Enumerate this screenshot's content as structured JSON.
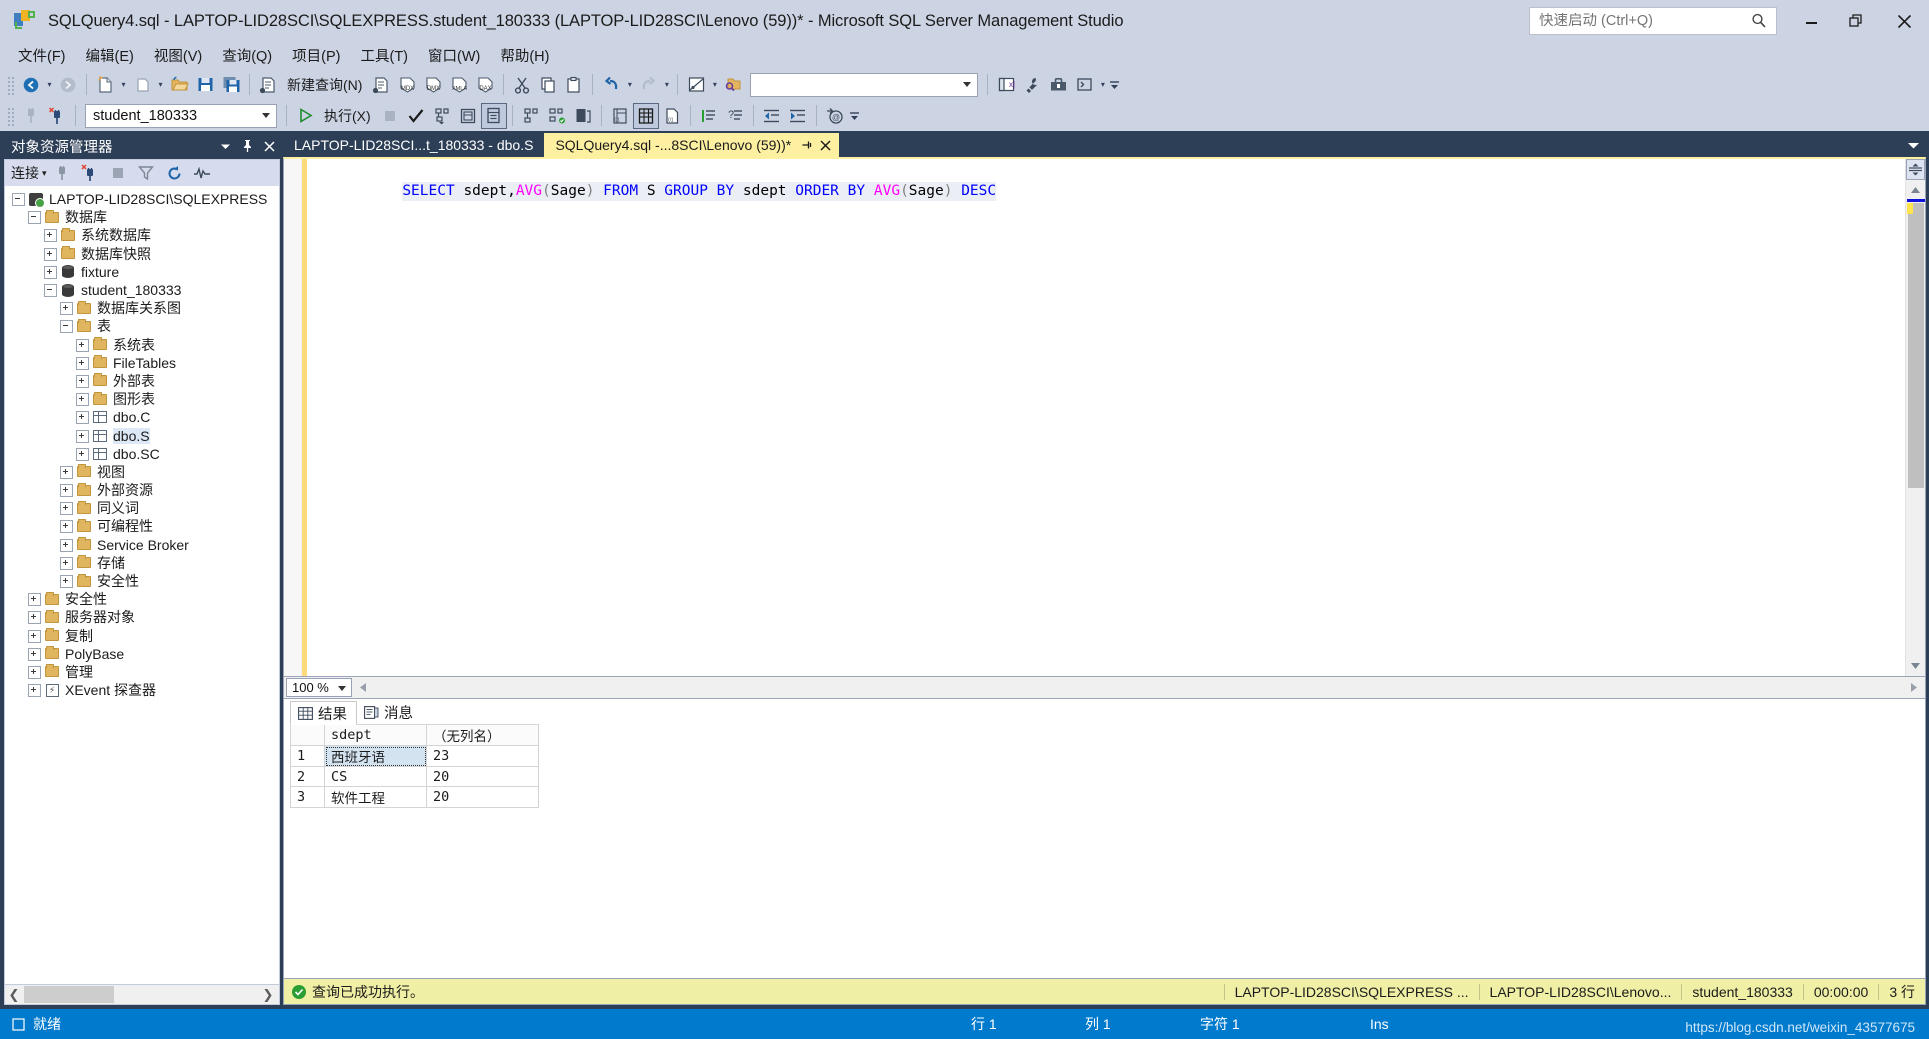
{
  "window": {
    "title": "SQLQuery4.sql - LAPTOP-LID28SCI\\SQLEXPRESS.student_180333 (LAPTOP-LID28SCI\\Lenovo (59))* - Microsoft SQL Server Management Studio",
    "app_icon": "ssms-icon",
    "minimize_label": "最小化",
    "restore_label": "还原",
    "close_label": "关闭"
  },
  "quick_launch": {
    "placeholder": "快速启动 (Ctrl+Q)",
    "value": "",
    "icon": "search-icon"
  },
  "menu": {
    "items": [
      {
        "label": "文件(F)",
        "name": "menu-file"
      },
      {
        "label": "编辑(E)",
        "name": "menu-edit"
      },
      {
        "label": "视图(V)",
        "name": "menu-view"
      },
      {
        "label": "查询(Q)",
        "name": "menu-query"
      },
      {
        "label": "项目(P)",
        "name": "menu-project"
      },
      {
        "label": "工具(T)",
        "name": "menu-tools"
      },
      {
        "label": "窗口(W)",
        "name": "menu-window"
      },
      {
        "label": "帮助(H)",
        "name": "menu-help"
      }
    ]
  },
  "toolbar_row1": {
    "new_query_label": "新建查询(N)",
    "buttons": [
      "navigate-back-icon",
      "navigate-forward-icon",
      "new-project-icon",
      "new-item-icon",
      "open-file-icon",
      "save-icon",
      "save-all-icon",
      "new-query-icon",
      "new-query-with-current-connection-icon",
      "new-mdx-query-icon",
      "new-dmx-query-icon",
      "new-xmla-query-icon",
      "new-dax-query-icon",
      "cut-icon",
      "copy-icon",
      "paste-icon",
      "undo-icon",
      "redo-icon",
      "comment-block-icon",
      "find-in-files-icon"
    ],
    "search_value": "",
    "right_buttons": [
      "object-explorer-icon",
      "properties-window-icon",
      "toolbox-icon",
      "command-prompt-icon"
    ]
  },
  "toolbar_row2": {
    "database_combo_value": "student_180333",
    "execute_label": "执行(X)",
    "buttons": [
      "connect-icon",
      "disconnect-icon",
      "execute-icon",
      "stop-icon",
      "parse-icon",
      "display-estimated-plan-icon",
      "query-options-icon",
      "include-actual-plan-icon",
      "include-client-statistics-icon",
      "include-live-statistics-icon",
      "results-to-text-icon",
      "results-to-grid-icon",
      "results-to-file-icon",
      "comment-lines-icon",
      "uncomment-lines-icon",
      "decrease-indent-icon",
      "increase-indent-icon",
      "specify-values-for-template-parameters-icon"
    ]
  },
  "object_explorer": {
    "title": "对象资源管理器",
    "title_buttons": [
      "window-position-chevron-icon",
      "auto-hide-pin-icon",
      "close-icon"
    ],
    "toolbar": {
      "connect_label": "连接",
      "buttons": [
        "connect-icon",
        "disconnect-icon",
        "stop-icon",
        "filter-icon",
        "refresh-icon",
        "activity-monitor-icon"
      ]
    },
    "tree": [
      {
        "label": "LAPTOP-LID28SCI\\SQLEXPRESS",
        "depth": 0,
        "state": "expanded",
        "icon": "server-icon",
        "selected": false
      },
      {
        "label": "数据库",
        "depth": 1,
        "state": "expanded",
        "icon": "folder-icon",
        "selected": false
      },
      {
        "label": "系统数据库",
        "depth": 2,
        "state": "collapsed",
        "icon": "folder-icon",
        "selected": false
      },
      {
        "label": "数据库快照",
        "depth": 2,
        "state": "collapsed",
        "icon": "folder-icon",
        "selected": false
      },
      {
        "label": "fixture",
        "depth": 2,
        "state": "collapsed",
        "icon": "database-icon",
        "selected": false
      },
      {
        "label": "student_180333",
        "depth": 2,
        "state": "expanded",
        "icon": "database-icon",
        "selected": false
      },
      {
        "label": "数据库关系图",
        "depth": 3,
        "state": "collapsed",
        "icon": "folder-icon",
        "selected": false
      },
      {
        "label": "表",
        "depth": 3,
        "state": "expanded",
        "icon": "folder-icon",
        "selected": false
      },
      {
        "label": "系统表",
        "depth": 4,
        "state": "collapsed",
        "icon": "folder-icon",
        "selected": false
      },
      {
        "label": "FileTables",
        "depth": 4,
        "state": "collapsed",
        "icon": "folder-icon",
        "selected": false
      },
      {
        "label": "外部表",
        "depth": 4,
        "state": "collapsed",
        "icon": "folder-icon",
        "selected": false
      },
      {
        "label": "图形表",
        "depth": 4,
        "state": "collapsed",
        "icon": "folder-icon",
        "selected": false
      },
      {
        "label": "dbo.C",
        "depth": 4,
        "state": "collapsed",
        "icon": "table-icon",
        "selected": false
      },
      {
        "label": "dbo.S",
        "depth": 4,
        "state": "collapsed",
        "icon": "table-icon",
        "selected": true
      },
      {
        "label": "dbo.SC",
        "depth": 4,
        "state": "collapsed",
        "icon": "table-icon",
        "selected": false
      },
      {
        "label": "视图",
        "depth": 3,
        "state": "collapsed",
        "icon": "folder-icon",
        "selected": false
      },
      {
        "label": "外部资源",
        "depth": 3,
        "state": "collapsed",
        "icon": "folder-icon",
        "selected": false
      },
      {
        "label": "同义词",
        "depth": 3,
        "state": "collapsed",
        "icon": "folder-icon",
        "selected": false
      },
      {
        "label": "可编程性",
        "depth": 3,
        "state": "collapsed",
        "icon": "folder-icon",
        "selected": false
      },
      {
        "label": "Service Broker",
        "depth": 3,
        "state": "collapsed",
        "icon": "folder-icon",
        "selected": false
      },
      {
        "label": "存储",
        "depth": 3,
        "state": "collapsed",
        "icon": "folder-icon",
        "selected": false
      },
      {
        "label": "安全性",
        "depth": 3,
        "state": "collapsed",
        "icon": "folder-icon",
        "selected": false
      },
      {
        "label": "安全性",
        "depth": 1,
        "state": "collapsed",
        "icon": "folder-icon",
        "selected": false
      },
      {
        "label": "服务器对象",
        "depth": 1,
        "state": "collapsed",
        "icon": "folder-icon",
        "selected": false
      },
      {
        "label": "复制",
        "depth": 1,
        "state": "collapsed",
        "icon": "folder-icon",
        "selected": false
      },
      {
        "label": "PolyBase",
        "depth": 1,
        "state": "collapsed",
        "icon": "folder-icon",
        "selected": false
      },
      {
        "label": "管理",
        "depth": 1,
        "state": "collapsed",
        "icon": "folder-icon",
        "selected": false
      },
      {
        "label": "XEvent 探查器",
        "depth": 1,
        "state": "collapsed",
        "icon": "xevent-icon",
        "selected": false
      }
    ]
  },
  "tabs": [
    {
      "label": "LAPTOP-LID28SCI...t_180333 - dbo.S",
      "active": false,
      "name": "tab-table-designer"
    },
    {
      "label": "SQLQuery4.sql -...8SCI\\Lenovo (59))*",
      "active": true,
      "name": "tab-sqlquery4"
    }
  ],
  "editor": {
    "tokens": [
      {
        "t": "SELECT",
        "k": "kw"
      },
      {
        "t": " ",
        "k": "sp"
      },
      {
        "t": "sdept",
        "k": "id"
      },
      {
        "t": ",",
        "k": "id"
      },
      {
        "t": "AVG",
        "k": "fn"
      },
      {
        "t": "(",
        "k": "pn"
      },
      {
        "t": "Sage",
        "k": "id"
      },
      {
        "t": ")",
        "k": "pn"
      },
      {
        "t": " ",
        "k": "sp"
      },
      {
        "t": "FROM",
        "k": "kw"
      },
      {
        "t": " ",
        "k": "sp"
      },
      {
        "t": "S",
        "k": "id"
      },
      {
        "t": " ",
        "k": "sp"
      },
      {
        "t": "GROUP",
        "k": "kw"
      },
      {
        "t": " ",
        "k": "sp"
      },
      {
        "t": "BY",
        "k": "kw"
      },
      {
        "t": " ",
        "k": "sp"
      },
      {
        "t": "sdept",
        "k": "id"
      },
      {
        "t": " ",
        "k": "sp"
      },
      {
        "t": "ORDER",
        "k": "kw"
      },
      {
        "t": " ",
        "k": "sp"
      },
      {
        "t": "BY",
        "k": "kw"
      },
      {
        "t": " ",
        "k": "sp"
      },
      {
        "t": "AVG",
        "k": "fn"
      },
      {
        "t": "(",
        "k": "pn"
      },
      {
        "t": "Sage",
        "k": "id"
      },
      {
        "t": ")",
        "k": "pn"
      },
      {
        "t": " ",
        "k": "sp"
      },
      {
        "t": "DESC",
        "k": "kw"
      }
    ],
    "plain_text": "SELECT sdept,AVG(Sage) FROM S GROUP BY sdept ORDER BY AVG(Sage) DESC",
    "zoom_level": "100 %"
  },
  "results": {
    "tabs": [
      {
        "label": "结果",
        "icon": "grid-icon",
        "active": true,
        "name": "tab-results"
      },
      {
        "label": "消息",
        "icon": "message-icon",
        "active": false,
        "name": "tab-messages"
      }
    ],
    "chart_data": {
      "type": "table",
      "columns": [
        "",
        "sdept",
        "（无列名）"
      ],
      "rows": [
        [
          "1",
          "西班牙语",
          "23"
        ],
        [
          "2",
          "CS",
          "20"
        ],
        [
          "3",
          "软件工程",
          "20"
        ]
      ],
      "selected_cell": {
        "row": 0,
        "col": 1
      }
    }
  },
  "query_status": {
    "message": "查询已成功执行。",
    "status_icon": "success-check-icon",
    "server": "LAPTOP-LID28SCI\\SQLEXPRESS ...",
    "user": "LAPTOP-LID28SCI\\Lenovo...",
    "database": "student_180333",
    "elapsed": "00:00:00",
    "rows": "3 行"
  },
  "app_status": {
    "ready_label": "就绪",
    "ready_icon": "page-icon",
    "line": "行 1",
    "column": "列 1",
    "char": "字符 1",
    "insert_mode": "Ins",
    "watermark": "https://blog.csdn.net/weixin_43577675"
  },
  "colors": {
    "accent_blue": "#007acc",
    "titlebar": "#ccd4e4",
    "chrome_dark": "#2d3e57",
    "active_tab": "#fdf0a1",
    "status_success": "#f0efa6",
    "keyword": "#0000ff",
    "function": "#ff00ff"
  }
}
